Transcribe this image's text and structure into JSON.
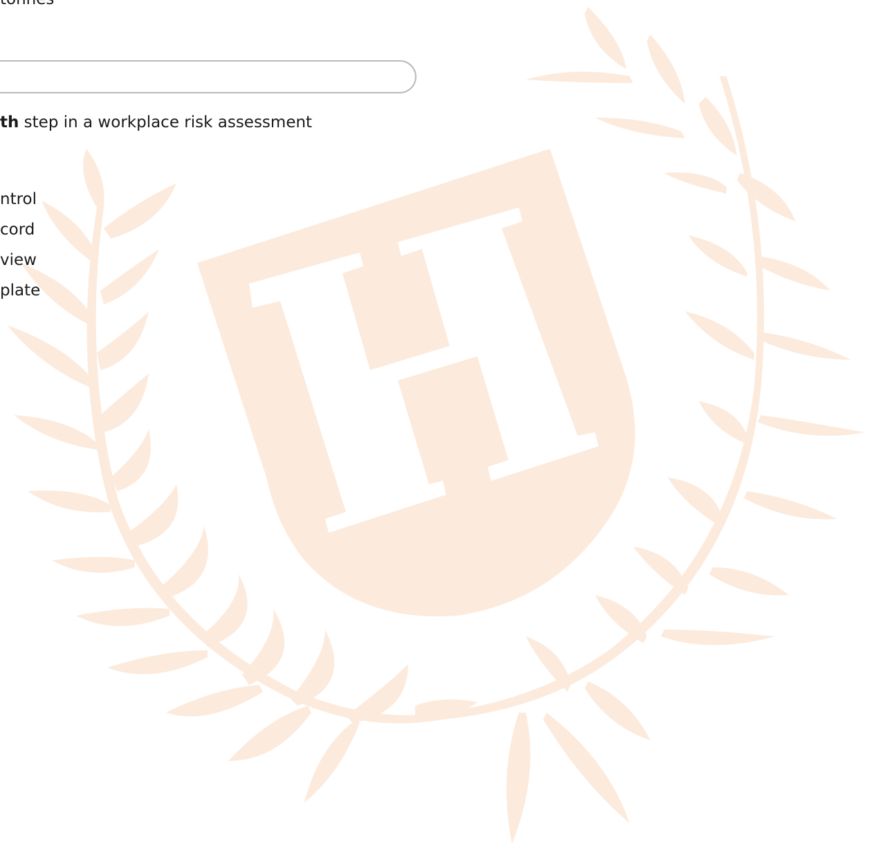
{
  "previous_question": {
    "fragment": "tonnes"
  },
  "answer_box": {
    "value": ""
  },
  "question": {
    "bold_part": "th",
    "rest": " step in a workplace risk assessment"
  },
  "options": [
    {
      "label": "ntrol"
    },
    {
      "label": "cord"
    },
    {
      "label": "view"
    },
    {
      "label": "plate"
    }
  ],
  "watermark": {
    "letter": "H",
    "color": "#fcebdd"
  }
}
